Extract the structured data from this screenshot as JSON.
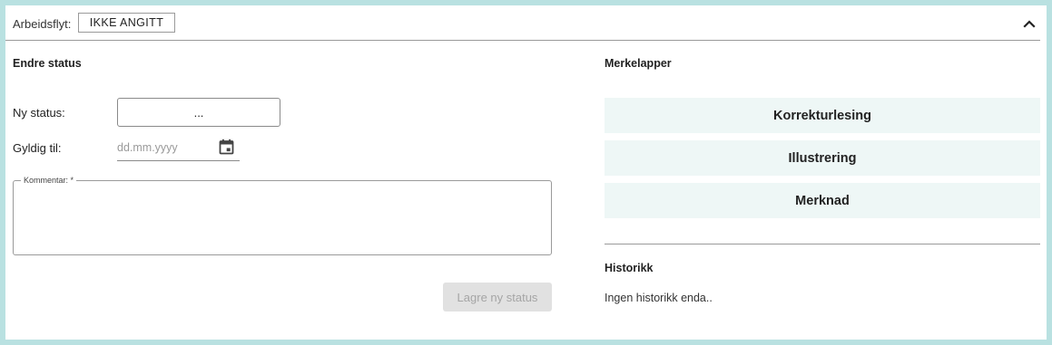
{
  "workflow": {
    "label": "Arbeidsflyt:",
    "value": "IKKE ANGITT",
    "collapse_icon": "chevron-up-icon"
  },
  "change_status": {
    "title": "Endre status",
    "new_status_label": "Ny status:",
    "new_status_value": "...",
    "valid_until_label": "Gyldig til:",
    "date_placeholder": "dd.mm.yyyy",
    "date_icon": "calendar-icon",
    "comment_label": "Kommentar: *",
    "comment_value": "",
    "save_label": "Lagre ny status",
    "save_enabled": false
  },
  "tags": {
    "title": "Merkelapper",
    "items": [
      {
        "label": "Korrekturlesing"
      },
      {
        "label": "Illustrering"
      },
      {
        "label": "Merknad"
      }
    ]
  },
  "history": {
    "title": "Historikk",
    "empty_text": "Ingen historikk enda.."
  },
  "colors": {
    "page_border": "#b9e1e1",
    "tag_background": "#eef7f6",
    "disabled_button": "#e1e1e1"
  }
}
